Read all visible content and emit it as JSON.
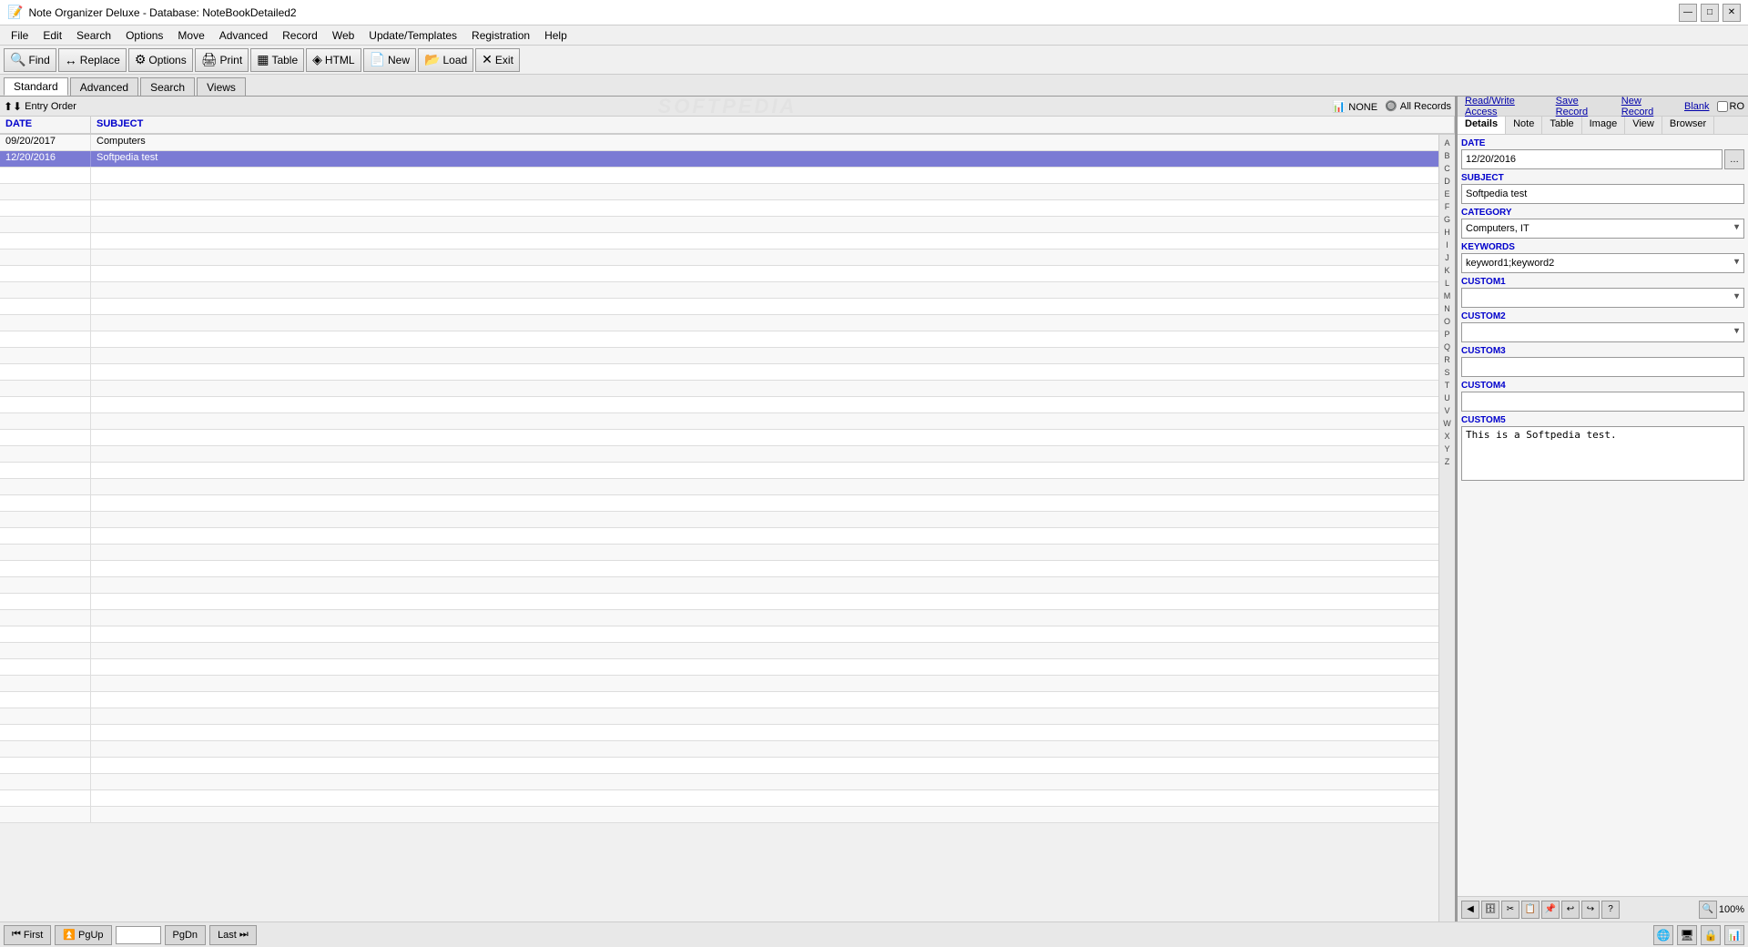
{
  "window": {
    "title": "Note Organizer Deluxe - Database: NoteBookDetailed2"
  },
  "titlebar": {
    "minimize": "—",
    "maximize": "□",
    "close": "✕"
  },
  "menu": {
    "items": [
      "File",
      "Edit",
      "Search",
      "Options",
      "Move",
      "Advanced",
      "Record",
      "Web",
      "Update/Templates",
      "Registration",
      "Help"
    ]
  },
  "toolbar": {
    "buttons": [
      {
        "label": "Find",
        "icon": "🔍",
        "name": "find-button"
      },
      {
        "label": "Replace",
        "icon": "↔",
        "name": "replace-button"
      },
      {
        "label": "Options",
        "icon": "⚙",
        "name": "options-button"
      },
      {
        "label": "Print",
        "icon": "🖨",
        "name": "print-button"
      },
      {
        "label": "Table",
        "icon": "▦",
        "name": "table-button"
      },
      {
        "label": "HTML",
        "icon": "◈",
        "name": "html-button"
      },
      {
        "label": "New",
        "icon": "📄",
        "name": "new-button"
      },
      {
        "label": "Load",
        "icon": "📂",
        "name": "load-button"
      },
      {
        "label": "Exit",
        "icon": "✕",
        "name": "exit-button"
      }
    ]
  },
  "tabs": {
    "items": [
      "Standard",
      "Advanced",
      "Search",
      "Views"
    ],
    "active": "Standard"
  },
  "sortbar": {
    "sort_label": "Entry Order",
    "filter_label": "NONE",
    "records_label": "All Records"
  },
  "columns": {
    "date": "DATE",
    "subject": "SUBJECT"
  },
  "records": [
    {
      "date": "09/20/2017",
      "subject": "Computers",
      "selected": false
    },
    {
      "date": "12/20/2016",
      "subject": "Softpedia test",
      "selected": true
    }
  ],
  "alphabet": [
    "A",
    "B",
    "C",
    "D",
    "E",
    "F",
    "G",
    "H",
    "I",
    "J",
    "K",
    "L",
    "M",
    "N",
    "O",
    "P",
    "Q",
    "R",
    "S",
    "T",
    "U",
    "V",
    "W",
    "X",
    "Y",
    "Z"
  ],
  "details": {
    "toolbar": {
      "read_write": "Read/Write Access",
      "save_record": "Save Record",
      "new_record": "New Record",
      "blank": "Blank",
      "ro_label": "RO"
    },
    "tabs": [
      "Details",
      "Note",
      "Table",
      "Image",
      "View",
      "Browser"
    ],
    "active_tab": "Details",
    "fields": {
      "date_label": "DATE",
      "date_value": "12/20/2016",
      "subject_label": "SUBJECT",
      "subject_value": "Softpedia test",
      "category_label": "CATEGORY",
      "category_value": "Computers, IT",
      "keywords_label": "KEYWORDS",
      "keywords_value": "keyword1;keyword2",
      "custom1_label": "CUSTOM1",
      "custom1_value": "",
      "custom2_label": "CUSTOM2",
      "custom2_value": "",
      "custom3_label": "CUSTOM3",
      "custom3_value": "",
      "custom4_label": "CUSTOM4",
      "custom4_value": "",
      "custom5_label": "CUSTOM5",
      "custom5_value": "This is a Softpedia test."
    }
  },
  "statusbar": {
    "first": "First",
    "pgup": "PgUp",
    "pgdn": "PgDn",
    "last": "Last",
    "page_value": ""
  },
  "zoom": {
    "level": "100%"
  },
  "watermark": "SOFTPEDIA"
}
